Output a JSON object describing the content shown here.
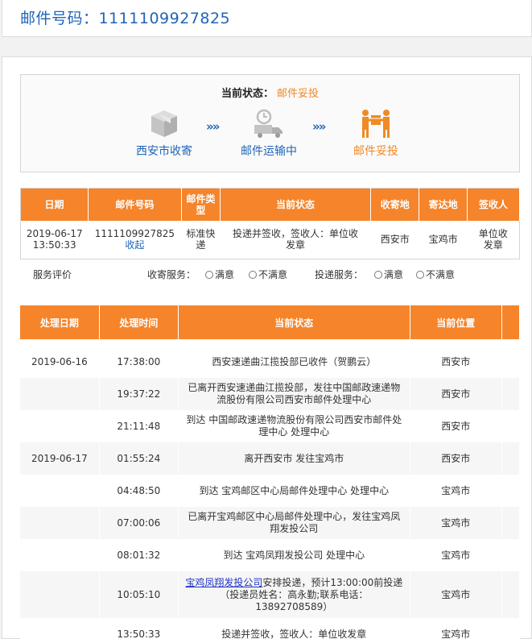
{
  "header": {
    "title": "邮件号码：1111109927825"
  },
  "status": {
    "label": "当前状态：",
    "value": "邮件妥投",
    "steps": [
      {
        "label": "西安市收寄",
        "icon": "package-box-icon"
      },
      {
        "label": "邮件运输中",
        "icon": "delivery-truck-icon"
      },
      {
        "label": "邮件妥投",
        "icon": "delivered-handover-icon"
      }
    ],
    "arrow": "»»"
  },
  "summary": {
    "headers": [
      "日期",
      "邮件号码",
      "邮件类型",
      "当前状态",
      "收寄地",
      "寄达地",
      "签收人"
    ],
    "row": {
      "date": "2019-06-17 13:50:33",
      "number": "1111109927825",
      "collapse": "收起",
      "type": "标准快递",
      "state": "投递并签收，签收人：单位收发章",
      "origin": "西安市",
      "dest": "宝鸡市",
      "signer": "单位收发章"
    },
    "evaluation": {
      "label": "服务评价",
      "collect_label": "收寄服务：",
      "deliver_label": "投递服务：",
      "satisfied": "满意",
      "unsatisfied": "不满意"
    }
  },
  "tracking": {
    "headers": [
      "处理日期",
      "处理时间",
      "当前状态",
      "当前位置"
    ],
    "rows": [
      {
        "date": "2019-06-16",
        "time": "17:38:00",
        "status": "西安速递曲江揽投部已收件（贺鹏云）",
        "location": "西安市"
      },
      {
        "date": "",
        "time": "19:37:22",
        "status": "已离开西安速递曲江揽投部，发往中国邮政速递物流股份有限公司西安市邮件处理中心",
        "location": "西安市"
      },
      {
        "date": "",
        "time": "21:11:48",
        "status": "到达 中国邮政速递物流股份有限公司西安市邮件处理中心 处理中心",
        "location": "西安市"
      },
      {
        "date": "2019-06-17",
        "time": "01:55:24",
        "status": "离开西安市 发往宝鸡市",
        "location": "西安市"
      },
      {
        "date": "",
        "time": "04:48:50",
        "status": "到达 宝鸡邮区中心局邮件处理中心 处理中心",
        "location": "宝鸡市"
      },
      {
        "date": "",
        "time": "07:00:06",
        "status": "已离开宝鸡邮区中心局邮件处理中心，发往宝鸡凤翔发投公司",
        "location": "宝鸡市"
      },
      {
        "date": "",
        "time": "08:01:32",
        "status": "到达 宝鸡凤翔发投公司 处理中心",
        "location": "宝鸡市"
      },
      {
        "date": "",
        "time": "10:05:10",
        "status_link": "宝鸡凤翔发投公司",
        "status": "安排投递，预计13:00:00前投递（投递员姓名：高永勤;联系电话：13892708589）",
        "location": "宝鸡市"
      },
      {
        "date": "",
        "time": "13:50:33",
        "status": "投递并签收，签收人：单位收发章",
        "location": "宝鸡市"
      }
    ]
  },
  "colors": {
    "accent": "#f5842a",
    "link": "#1f64b8",
    "status_orange": "#f08a24"
  }
}
